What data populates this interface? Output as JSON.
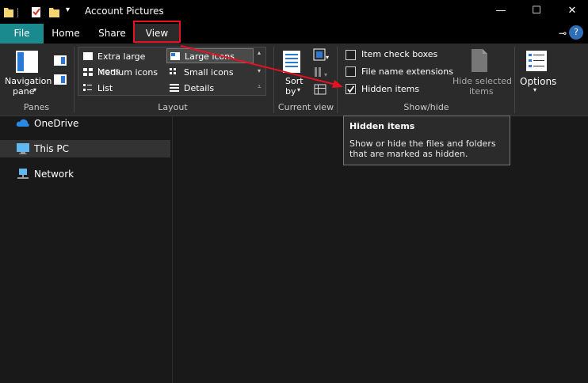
{
  "window": {
    "title": "Account Pictures",
    "minimize_glyph": "—",
    "maximize_glyph": "☐",
    "close_glyph": "✕",
    "help_glyph": "?",
    "pin_glyph": "⊸"
  },
  "tabs": [
    {
      "label": "File"
    },
    {
      "label": "Home"
    },
    {
      "label": "Share"
    },
    {
      "label": "View"
    }
  ],
  "ribbon": {
    "panes": {
      "nav_pane_label1": "Navigation",
      "nav_pane_label2": "pane",
      "group": "Panes"
    },
    "layout": {
      "items": [
        "Extra large icons",
        "Large icons",
        "Medium icons",
        "Small icons",
        "List",
        "Details"
      ],
      "group": "Layout"
    },
    "current_view": {
      "sort_label1": "Sort",
      "sort_label2": "by",
      "group": "Current view"
    },
    "show_hide": {
      "item_check_boxes": "Item check boxes",
      "file_name_extensions": "File name extensions",
      "hidden_items": "Hidden items",
      "hide_selected_1": "Hide selected",
      "hide_selected_2": "items",
      "group": "Show/hide"
    },
    "options": {
      "label": "Options"
    }
  },
  "tooltip": {
    "title": "Hidden items",
    "line1": "Show or hide the files and folders",
    "line2": "that are marked as hidden."
  },
  "navigation": [
    {
      "label": "OneDrive",
      "icon": "cloud-icon"
    },
    {
      "label": "This PC",
      "icon": "computer-icon"
    },
    {
      "label": "Network",
      "icon": "network-icon"
    }
  ],
  "colors": {
    "file_tab": "#1a8a8f",
    "highlight": "#e81123",
    "annotation_arrow": "#e81123"
  }
}
